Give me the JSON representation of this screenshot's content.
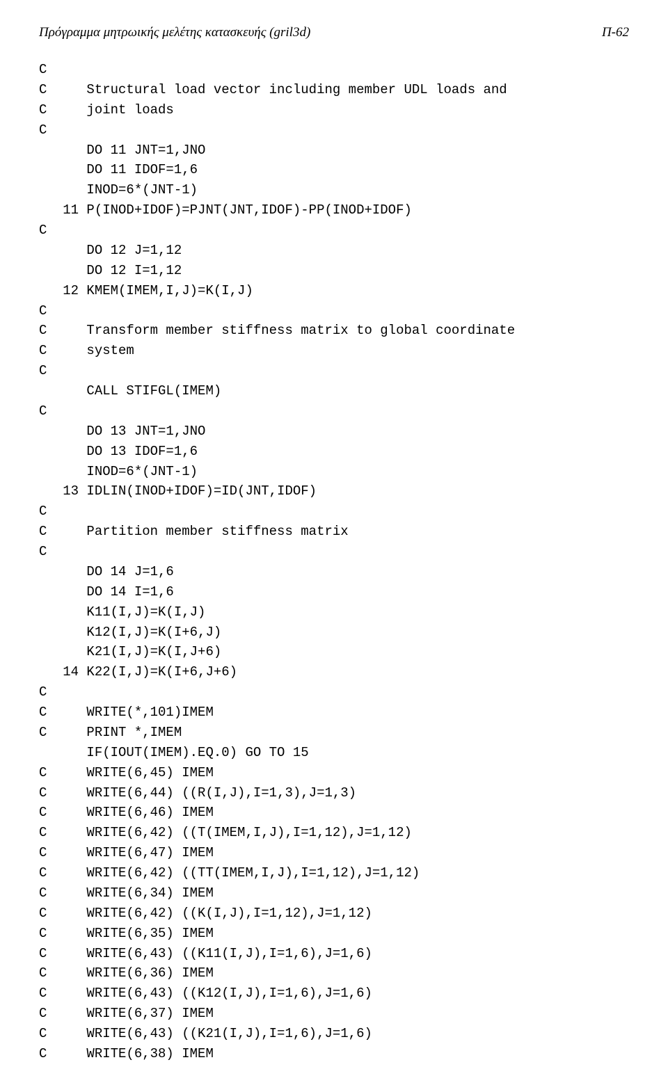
{
  "header": {
    "left": "Πρόγραμμα μητρωικής μελέτης κατασκευής (gril3d)",
    "right": "Π-62"
  },
  "code": "C\nC     Structural load vector including member UDL loads and\nC     joint loads\nC\n      DO 11 JNT=1,JNO\n      DO 11 IDOF=1,6\n      INOD=6*(JNT-1)\n   11 P(INOD+IDOF)=PJNT(JNT,IDOF)-PP(INOD+IDOF)\nC\n      DO 12 J=1,12\n      DO 12 I=1,12\n   12 KMEM(IMEM,I,J)=K(I,J)\nC\nC     Transform member stiffness matrix to global coordinate\nC     system\nC\n      CALL STIFGL(IMEM)\nC\n      DO 13 JNT=1,JNO\n      DO 13 IDOF=1,6\n      INOD=6*(JNT-1)\n   13 IDLIN(INOD+IDOF)=ID(JNT,IDOF)\nC\nC     Partition member stiffness matrix\nC\n      DO 14 J=1,6\n      DO 14 I=1,6\n      K11(I,J)=K(I,J)\n      K12(I,J)=K(I+6,J)\n      K21(I,J)=K(I,J+6)\n   14 K22(I,J)=K(I+6,J+6)\nC\nC     WRITE(*,101)IMEM\nC     PRINT *,IMEM\n      IF(IOUT(IMEM).EQ.0) GO TO 15\nC     WRITE(6,45) IMEM\nC     WRITE(6,44) ((R(I,J),I=1,3),J=1,3)\nC     WRITE(6,46) IMEM\nC     WRITE(6,42) ((T(IMEM,I,J),I=1,12),J=1,12)\nC     WRITE(6,47) IMEM\nC     WRITE(6,42) ((TT(IMEM,I,J),I=1,12),J=1,12)\nC     WRITE(6,34) IMEM\nC     WRITE(6,42) ((K(I,J),I=1,12),J=1,12)\nC     WRITE(6,35) IMEM\nC     WRITE(6,43) ((K11(I,J),I=1,6),J=1,6)\nC     WRITE(6,36) IMEM\nC     WRITE(6,43) ((K12(I,J),I=1,6),J=1,6)\nC     WRITE(6,37) IMEM\nC     WRITE(6,43) ((K21(I,J),I=1,6),J=1,6)\nC     WRITE(6,38) IMEM"
}
